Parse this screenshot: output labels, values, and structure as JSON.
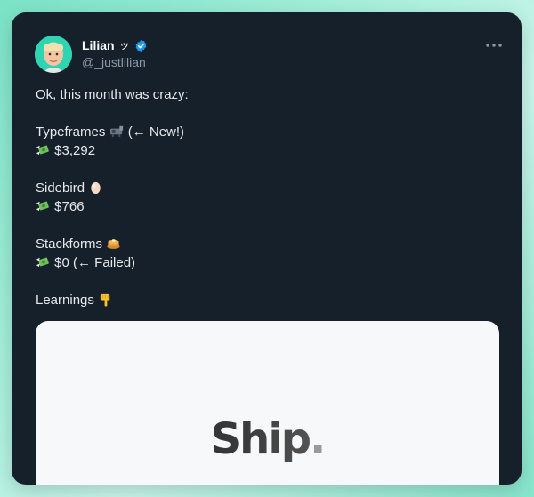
{
  "tweet": {
    "author_name": "Lilian",
    "author_suffix": "ッ",
    "handle": "@_justlilian",
    "lines": [
      "Ok, this month was crazy:",
      "Typeframes",
      "(← New!)",
      "$3,292",
      "Sidebird",
      "$766",
      "Stackforms",
      "$0 (← Failed)",
      "Learnings"
    ]
  },
  "media": {
    "title": "Ship",
    "dot": "."
  },
  "colors": {
    "card_bg": "#15202b",
    "verified": "#1d9bf0",
    "text": "#e7e9ea",
    "muted": "#8b98a5"
  },
  "icons": [
    "verified-badge-icon",
    "more-options-icon",
    "money-with-wings-icon",
    "projector-icon",
    "egg-icon",
    "pancakes-icon",
    "pointing-down-icon"
  ]
}
